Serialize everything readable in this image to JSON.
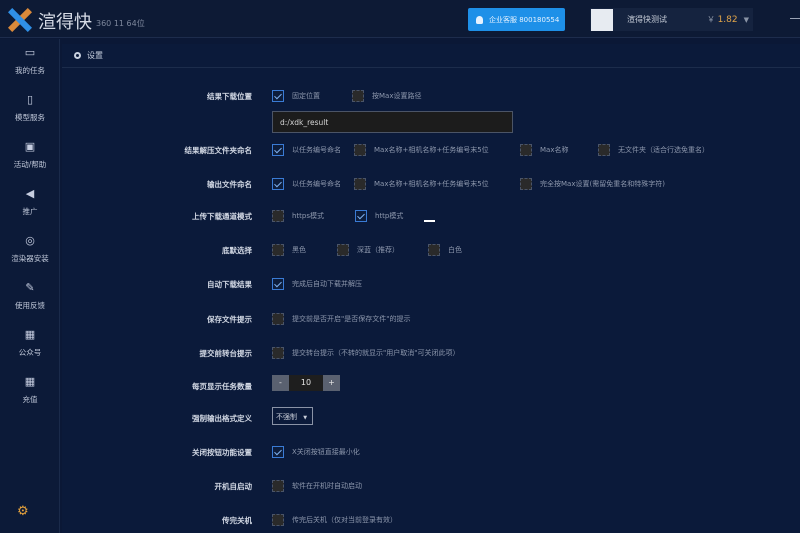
{
  "app": {
    "name": "渲得快",
    "version": "360 11 64位"
  },
  "header": {
    "enterprise_btn": "企业客服 800180554",
    "username": "渲得快测试",
    "balance_symbol": "￥",
    "balance": "1.82"
  },
  "sidebar": [
    {
      "icon": "task-icon",
      "label": "我的任务"
    },
    {
      "icon": "document-icon",
      "label": "模型服务"
    },
    {
      "icon": "gift-icon",
      "label": "活动/帮助"
    },
    {
      "icon": "megaphone-icon",
      "label": "推广"
    },
    {
      "icon": "compass-icon",
      "label": "渲染器安装"
    },
    {
      "icon": "edit-icon",
      "label": "使用反馈"
    },
    {
      "icon": "qrcode-icon",
      "label": "公众号"
    },
    {
      "icon": "qrcode-icon",
      "label": "充值"
    }
  ],
  "page": {
    "title": "设置"
  },
  "settings": {
    "download_location": {
      "label": "结果下载位置",
      "options": [
        {
          "text": "固定位置",
          "checked": true
        },
        {
          "text": "按Max设置路径",
          "checked": false
        }
      ],
      "path": "d:/xdk_result"
    },
    "folder_naming": {
      "label": "结果解压文件夹命名",
      "options": [
        {
          "text": "以任务编号命名",
          "checked": true
        },
        {
          "text": "Max名称+相机名称+任务编号末5位",
          "checked": false
        },
        {
          "text": "Max名称",
          "checked": false
        },
        {
          "text": "无文件夹（适合行选免重名）",
          "checked": false
        }
      ]
    },
    "output_naming": {
      "label": "输出文件命名",
      "options": [
        {
          "text": "以任务编号命名",
          "checked": true
        },
        {
          "text": "Max名称+相机名称+任务编号末5位",
          "checked": false
        },
        {
          "text": "完全按Max设置(需留免重名和特殊字符)",
          "checked": false
        }
      ]
    },
    "transfer_mode": {
      "label": "上传下载通道模式",
      "options": [
        {
          "text": "https模式",
          "checked": false
        },
        {
          "text": "http模式",
          "checked": true
        }
      ]
    },
    "background": {
      "label": "底默选择",
      "options": [
        {
          "text": "黑色",
          "checked": false
        },
        {
          "text": "深蓝（推荐）",
          "checked": false
        },
        {
          "text": "白色",
          "checked": false
        }
      ]
    },
    "auto_download": {
      "label": "自动下载结果",
      "options": [
        {
          "text": "完成后自动下载并解压",
          "checked": true
        }
      ]
    },
    "save_prompt": {
      "label": "保存文件提示",
      "options": [
        {
          "text": "提交前是否开启\"是否保存文件\"的提示",
          "checked": false
        }
      ]
    },
    "submit_prompt": {
      "label": "提交前转台提示",
      "options": [
        {
          "text": "提交转台提示（不转的就显示\"用户取消\"可关闭此项）",
          "checked": false
        }
      ]
    },
    "page_size": {
      "label": "每页显示任务数量",
      "minus": "-",
      "value": "10",
      "plus": "+"
    },
    "output_format": {
      "label": "强制输出格式定义",
      "value": "不强制"
    },
    "close_button": {
      "label": "关闭按钮功能设置",
      "options": [
        {
          "text": "X关闭按钮直接最小化",
          "checked": true
        }
      ]
    },
    "autostart": {
      "label": "开机自启动",
      "options": [
        {
          "text": "软件在开机时自动启动",
          "checked": false
        }
      ]
    },
    "shutdown": {
      "label": "传完关机",
      "options": [
        {
          "text": "传完后关机（仅对当前登录有效）",
          "checked": false
        }
      ]
    }
  }
}
